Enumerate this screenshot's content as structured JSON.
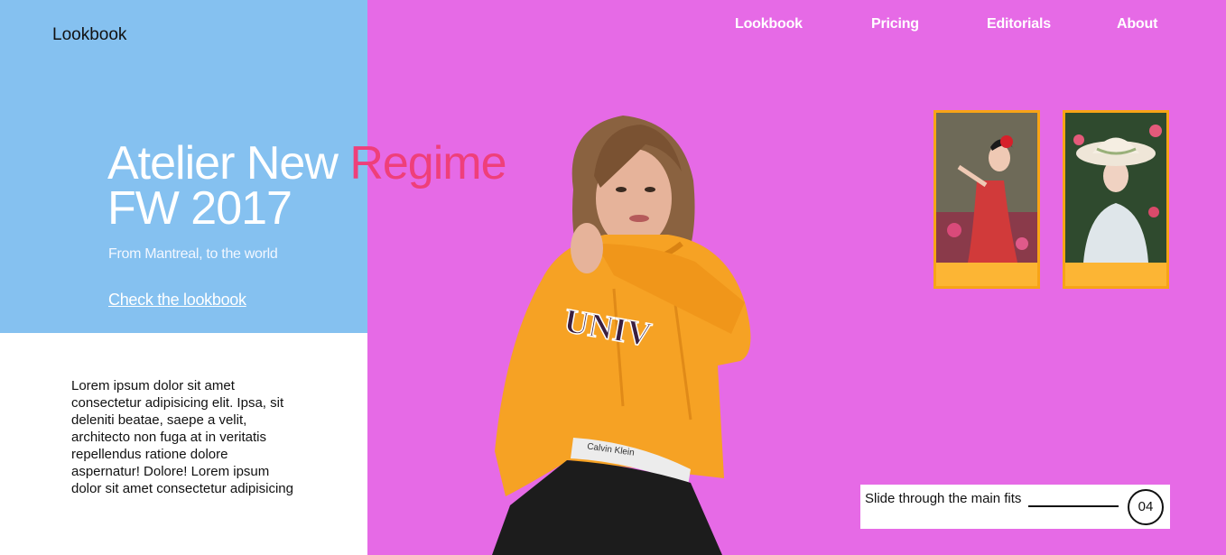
{
  "brand": {
    "logo": "Lookbook"
  },
  "nav": {
    "items": [
      {
        "label": "Lookbook"
      },
      {
        "label": "Pricing"
      },
      {
        "label": "Editorials"
      },
      {
        "label": "About"
      }
    ]
  },
  "hero": {
    "title_part1": "Atelier New ",
    "title_accent": "Regime",
    "title_line2": "FW 2017",
    "subtitle": "From Mantreal, to the world",
    "cta": "Check the lookbook"
  },
  "body": {
    "text": "Lorem ipsum dolor sit amet consectetur adipisicing elit. Ipsa, sit deleniti beatae, saepe a velit, architecto non fuga at in veritatis repellendus ratione dolore aspernatur! Dolore! Lorem ipsum dolor sit amet consectetur adipisicing"
  },
  "hoodie": {
    "print": "UNIV",
    "waistband": "Calvin Klein"
  },
  "slider": {
    "label": "Slide through the main fits",
    "number": "04"
  },
  "colors": {
    "left_panel": "#85c1f0",
    "right_panel": "#e66ae6",
    "accent": "#ef3f7a",
    "thumb_border": "#f7a416",
    "thumb_fill": "#fcb534",
    "hoodie": "#f6a224"
  }
}
